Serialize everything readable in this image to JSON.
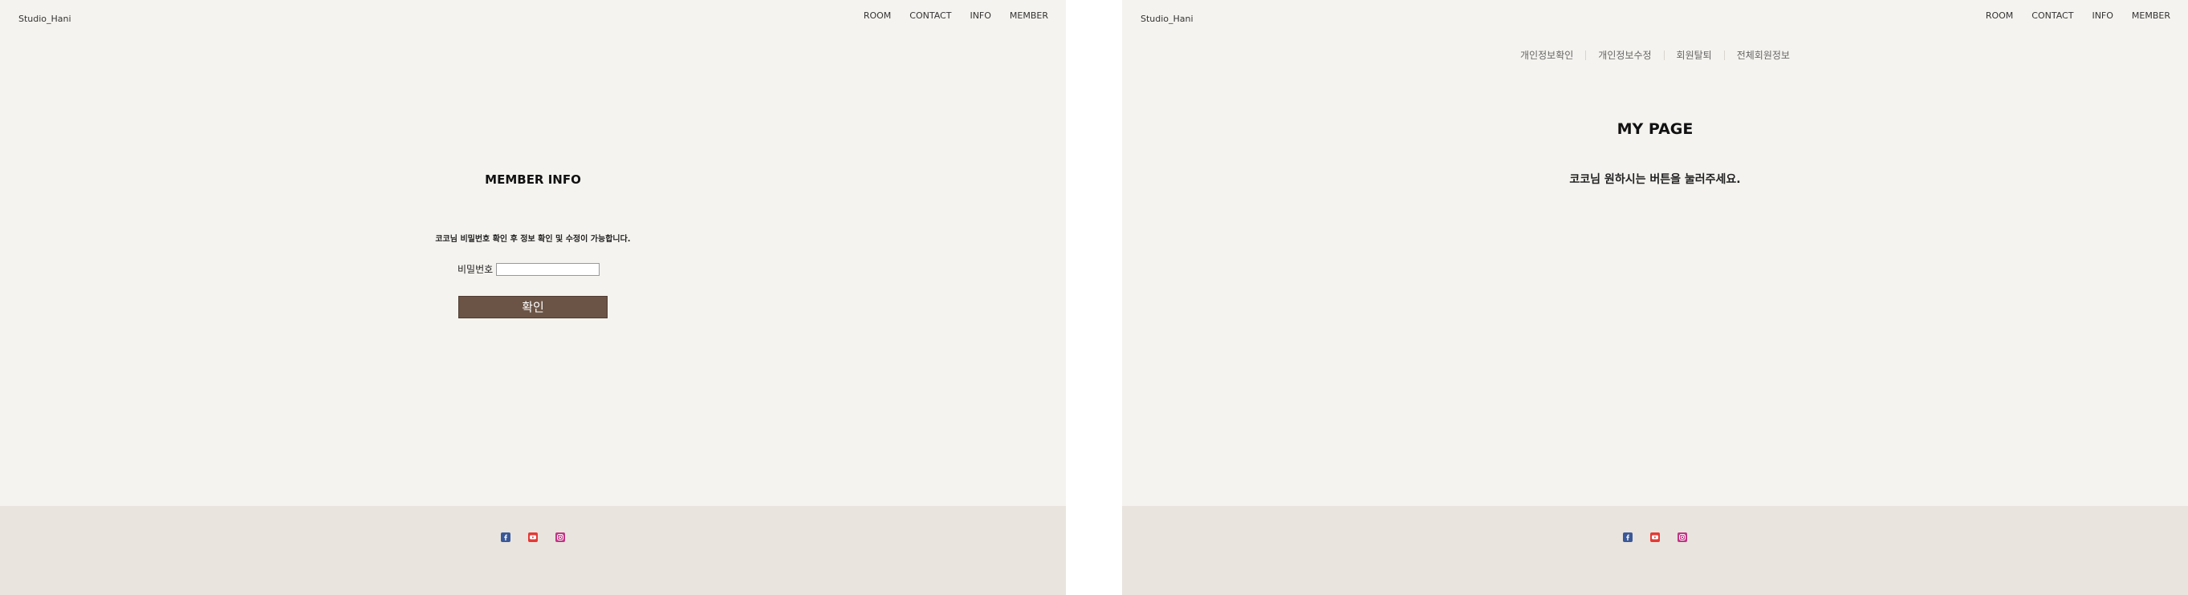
{
  "left": {
    "logo": "Studio_Hani",
    "nav": [
      "ROOM",
      "CONTACT",
      "INFO",
      "MEMBER"
    ],
    "title": "MEMBER INFO",
    "notice": "코코님 비밀번호 확인 후 정보 확인 및 수정이 가능합니다.",
    "password_label": "비밀번호",
    "password_value": "",
    "confirm_label": "확인"
  },
  "right": {
    "logo": "Studio_Hani",
    "nav": [
      "ROOM",
      "CONTACT",
      "INFO",
      "MEMBER"
    ],
    "subnav": [
      "개인정보확인",
      "개인정보수정",
      "회원탈퇴",
      "전체회원정보"
    ],
    "title": "MY PAGE",
    "message": "코코님 원하시는 버튼을 눌러주세요."
  },
  "footer": {
    "icons": [
      "facebook-icon",
      "youtube-icon",
      "instagram-icon"
    ],
    "colors": {
      "facebook": "#3b5998",
      "youtube": "#e53935",
      "instagram": "#c13584",
      "background": "#e9e4de",
      "button": "#6b5446"
    }
  }
}
